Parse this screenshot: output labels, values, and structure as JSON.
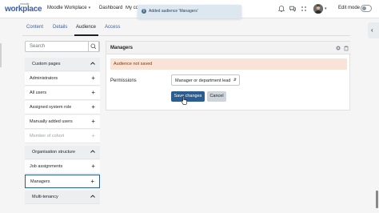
{
  "header": {
    "logo_sup": "moodle",
    "logo_main": "workplace",
    "nav": {
      "workplace_label": "Moodle Workplace",
      "dashboard_label": "Dashboard",
      "mycourses_label": "My co"
    },
    "edit_mode_label": "Edit mode"
  },
  "toast": {
    "message": "Added audience 'Managers'",
    "icon": "info-icon"
  },
  "tabs": [
    {
      "label": "Content"
    },
    {
      "label": "Details"
    },
    {
      "label": "Audience"
    },
    {
      "label": "Access"
    }
  ],
  "sidebar": {
    "search_placeholder": "Search",
    "sections": [
      {
        "label": "Custom pages",
        "kind": "head"
      },
      {
        "label": "Administrators",
        "kind": "item"
      },
      {
        "label": "All users",
        "kind": "item"
      },
      {
        "label": "Assigned system role",
        "kind": "item"
      },
      {
        "label": "Manually added users",
        "kind": "item"
      },
      {
        "label": "Member of cohort",
        "kind": "muted"
      },
      {
        "label": "Organisation structure",
        "kind": "head"
      },
      {
        "label": "Job assignments",
        "kind": "item"
      },
      {
        "label": "Managers",
        "kind": "selected"
      },
      {
        "label": "Multi-tenancy",
        "kind": "head"
      }
    ],
    "add_symbol": "+"
  },
  "panel": {
    "title": "Managers",
    "alert_text": "Audience not saved",
    "permissions_label": "Permissions",
    "permissions_value": "Manager or department lead",
    "save_label": "Save changes",
    "cancel_label": "Cancel"
  },
  "colors": {
    "primary": "#2b5d8f",
    "alert_bg": "#f8e3d6",
    "toast_bg": "#dde7ef"
  }
}
